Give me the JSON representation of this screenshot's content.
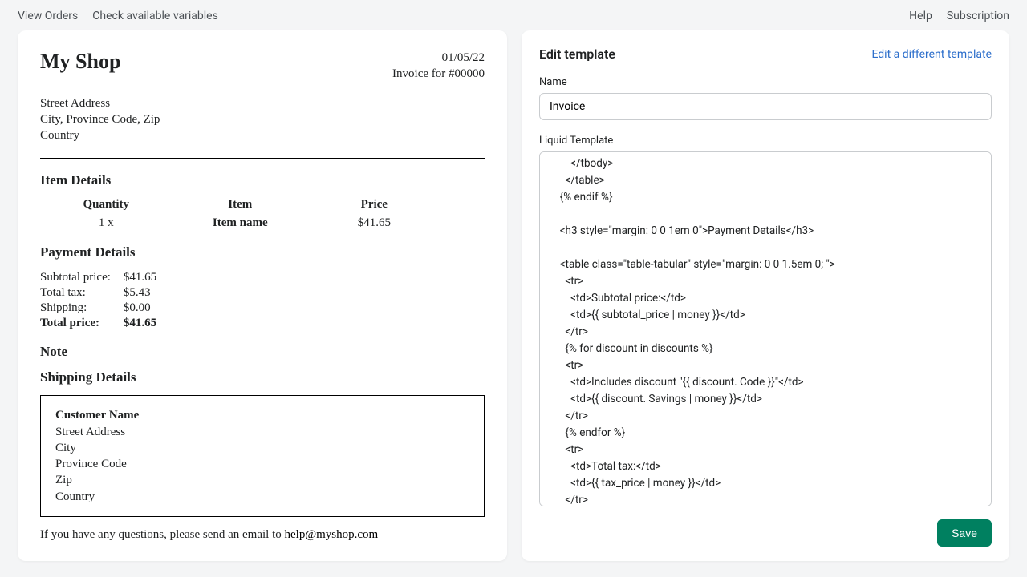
{
  "topbar": {
    "view_orders": "View Orders",
    "check_vars": "Check available variables",
    "help": "Help",
    "subscription": "Subscription"
  },
  "preview": {
    "shop_name": "My Shop",
    "date": "01/05/22",
    "invoice_for": "Invoice for #00000",
    "address": {
      "street": "Street Address",
      "city_line": "City, Province Code, Zip",
      "country": "Country"
    },
    "sections": {
      "item_details": "Item Details",
      "payment_details": "Payment Details",
      "note": "Note",
      "shipping_details": "Shipping Details"
    },
    "items_header": {
      "qty": "Quantity",
      "item": "Item",
      "price": "Price"
    },
    "items_row": {
      "qty": "1 x",
      "item": "Item name",
      "price": "$41.65"
    },
    "payment": {
      "subtotal_label": "Subtotal price:",
      "subtotal_value": "$41.65",
      "tax_label": "Total tax:",
      "tax_value": "$5.43",
      "shipping_label": "Shipping:",
      "shipping_value": "$0.00",
      "total_label": "Total price:",
      "total_value": "$41.65"
    },
    "shipping": {
      "name": "Customer Name",
      "street": "Street Address",
      "city": "City",
      "province": "Province Code",
      "zip": "Zip",
      "country": "Country"
    },
    "footer_text": "If you have any questions, please send an email to ",
    "footer_email": "help@myshop.com"
  },
  "editor": {
    "title": "Edit template",
    "switch_link": "Edit a different template",
    "name_label": "Name",
    "name_value": "Invoice",
    "liquid_label": "Liquid Template",
    "liquid_code": "      </tbody>\n    </table>\n  {% endif %}\n\n  <h3 style=\"margin: 0 0 1em 0\">Payment Details</h3>\n\n  <table class=\"table-tabular\" style=\"margin: 0 0 1.5em 0; \">\n    <tr>\n      <td>Subtotal price:</td>\n      <td>{{ subtotal_price | money }}</td>\n    </tr>\n    {% for discount in discounts %}\n    <tr>\n      <td>Includes discount \"{{ discount. Code }}\"</td>\n      <td>{{ discount. Savings | money }}</td>\n    </tr>\n    {% endfor %}\n    <tr>\n      <td>Total tax:</td>\n      <td>{{ tax_price | money }}</td>\n    </tr>\n    <tr>",
    "save": "Save"
  }
}
